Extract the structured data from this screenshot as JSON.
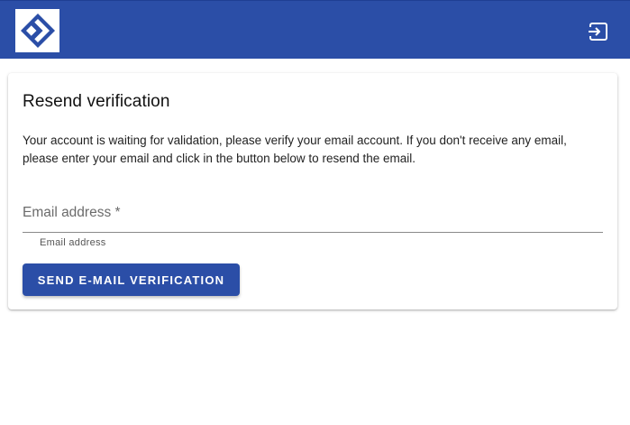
{
  "header": {
    "logo_icon": "diamond-chevron-logo-icon",
    "logout_icon": "logout-icon",
    "brand_color": "#2b4ea7"
  },
  "card": {
    "title": "Resend verification",
    "description": "Your account is waiting for validation, please verify your email account. If you don't receive any email, please enter your email and click in the button below to resend the email.",
    "email_field": {
      "placeholder": "Email address *",
      "value": "",
      "helper_text": "Email address"
    },
    "submit_label": "SEND E-MAIL VERIFICATION"
  }
}
